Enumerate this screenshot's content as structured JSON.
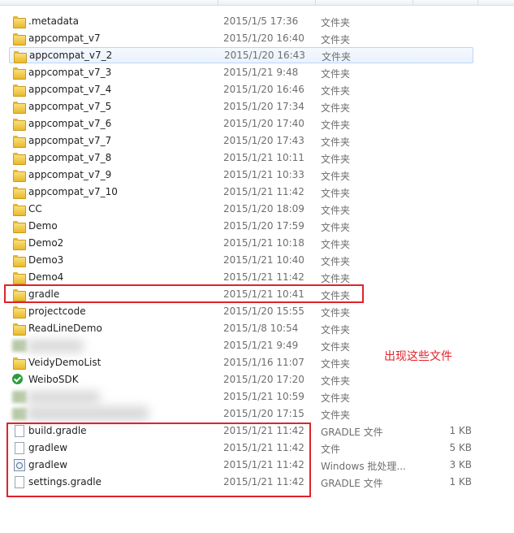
{
  "files": [
    {
      "name": ".metadata",
      "date": "2015/1/5 17:36",
      "type": "文件夹",
      "size": "",
      "icon": "folder-icon"
    },
    {
      "name": "appcompat_v7",
      "date": "2015/1/20 16:40",
      "type": "文件夹",
      "size": "",
      "icon": "folder-icon"
    },
    {
      "name": "appcompat_v7_2",
      "date": "2015/1/20 16:43",
      "type": "文件夹",
      "size": "",
      "icon": "folder-icon",
      "selected": true
    },
    {
      "name": "appcompat_v7_3",
      "date": "2015/1/21 9:48",
      "type": "文件夹",
      "size": "",
      "icon": "folder-icon"
    },
    {
      "name": "appcompat_v7_4",
      "date": "2015/1/20 16:46",
      "type": "文件夹",
      "size": "",
      "icon": "folder-icon"
    },
    {
      "name": "appcompat_v7_5",
      "date": "2015/1/20 17:34",
      "type": "文件夹",
      "size": "",
      "icon": "folder-icon"
    },
    {
      "name": "appcompat_v7_6",
      "date": "2015/1/20 17:40",
      "type": "文件夹",
      "size": "",
      "icon": "folder-icon"
    },
    {
      "name": "appcompat_v7_7",
      "date": "2015/1/20 17:43",
      "type": "文件夹",
      "size": "",
      "icon": "folder-icon"
    },
    {
      "name": "appcompat_v7_8",
      "date": "2015/1/21 10:11",
      "type": "文件夹",
      "size": "",
      "icon": "folder-icon"
    },
    {
      "name": "appcompat_v7_9",
      "date": "2015/1/21 10:33",
      "type": "文件夹",
      "size": "",
      "icon": "folder-icon"
    },
    {
      "name": "appcompat_v7_10",
      "date": "2015/1/21 11:42",
      "type": "文件夹",
      "size": "",
      "icon": "folder-icon"
    },
    {
      "name": "CC",
      "date": "2015/1/20 18:09",
      "type": "文件夹",
      "size": "",
      "icon": "folder-icon"
    },
    {
      "name": "Demo",
      "date": "2015/1/20 17:59",
      "type": "文件夹",
      "size": "",
      "icon": "folder-icon"
    },
    {
      "name": "Demo2",
      "date": "2015/1/21 10:18",
      "type": "文件夹",
      "size": "",
      "icon": "folder-icon"
    },
    {
      "name": "Demo3",
      "date": "2015/1/21 10:40",
      "type": "文件夹",
      "size": "",
      "icon": "folder-icon"
    },
    {
      "name": "Demo4",
      "date": "2015/1/21 11:42",
      "type": "文件夹",
      "size": "",
      "icon": "folder-icon"
    },
    {
      "name": "gradle",
      "date": "2015/1/21 10:41",
      "type": "文件夹",
      "size": "",
      "icon": "folder-icon"
    },
    {
      "name": "projectcode",
      "date": "2015/1/20 15:55",
      "type": "文件夹",
      "size": "",
      "icon": "folder-icon"
    },
    {
      "name": "ReadLineDemo",
      "date": "2015/1/8 10:54",
      "type": "文件夹",
      "size": "",
      "icon": "folder-icon"
    },
    {
      "name": "",
      "date": "2015/1/21 9:49",
      "type": "文件夹",
      "size": "",
      "icon": "blur-icon"
    },
    {
      "name": "VeidyDemoList",
      "date": "2015/1/16 11:07",
      "type": "文件夹",
      "size": "",
      "icon": "folder-icon"
    },
    {
      "name": "WeiboSDK",
      "date": "2015/1/20 17:20",
      "type": "文件夹",
      "size": "",
      "icon": "check-icon"
    },
    {
      "name": "",
      "date": "2015/1/21 10:59",
      "type": "文件夹",
      "size": "",
      "icon": "blur-icon"
    },
    {
      "name": "",
      "date": "2015/1/20 17:15",
      "type": "文件夹",
      "size": "",
      "icon": "blur-icon"
    },
    {
      "name": "build.gradle",
      "date": "2015/1/21 11:42",
      "type": "GRADLE 文件",
      "size": "1 KB",
      "icon": "file-icon"
    },
    {
      "name": "gradlew",
      "date": "2015/1/21 11:42",
      "type": "文件",
      "size": "5 KB",
      "icon": "file-icon"
    },
    {
      "name": "gradlew",
      "date": "2015/1/21 11:42",
      "type": "Windows 批处理...",
      "size": "3 KB",
      "icon": "batch-icon"
    },
    {
      "name": "settings.gradle",
      "date": "2015/1/21 11:42",
      "type": "GRADLE 文件",
      "size": "1 KB",
      "icon": "file-icon"
    }
  ],
  "annotation": {
    "text": "出现这些文件",
    "color": "#e0232a"
  },
  "colors": {
    "selection_border": "#b8d6fb",
    "annotation_red": "#e0232a"
  }
}
